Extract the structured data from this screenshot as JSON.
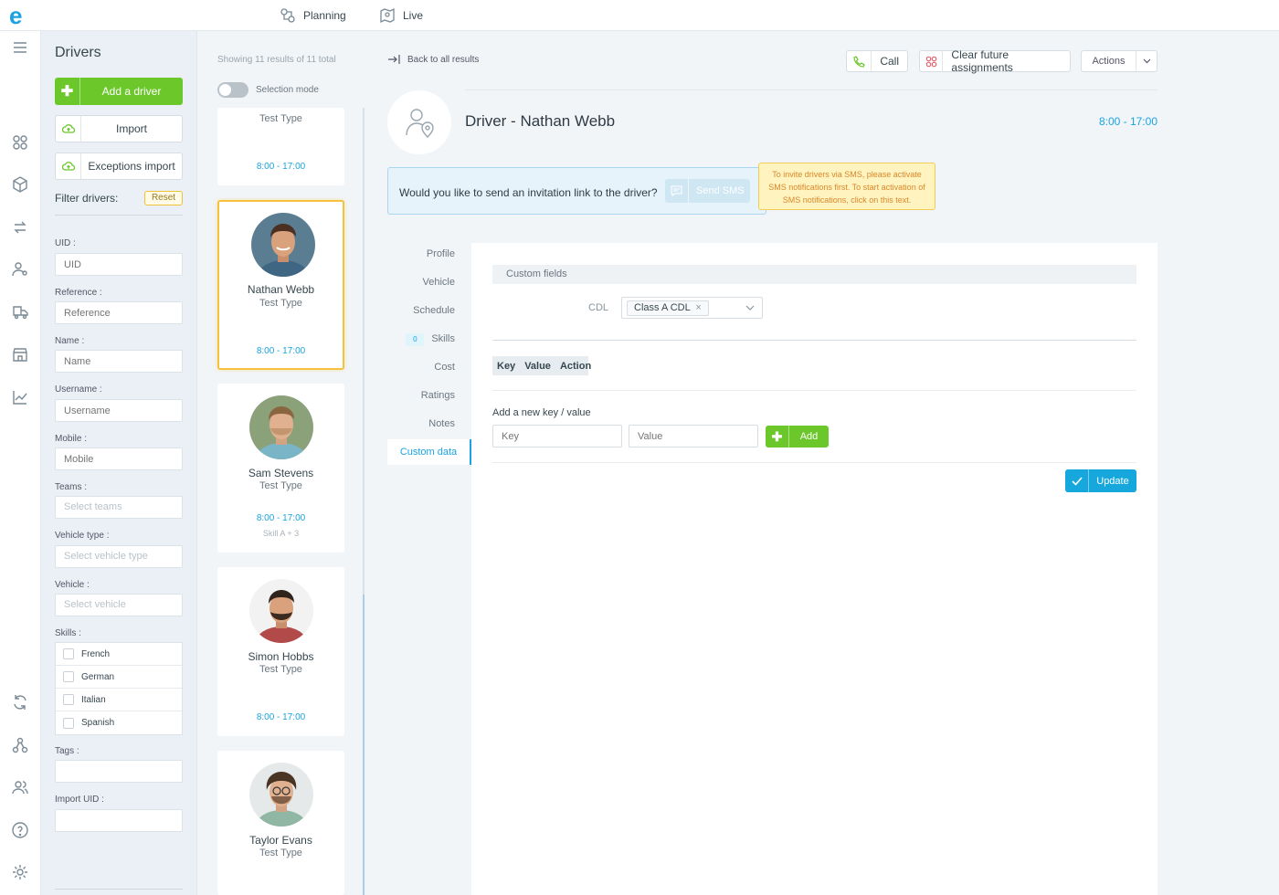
{
  "app": {
    "logo": "e",
    "nav": [
      {
        "label": "Planning",
        "icon": "planning-icon"
      },
      {
        "label": "Live",
        "icon": "live-map-icon"
      }
    ]
  },
  "rail_icons": [
    "menu-icon",
    "planning-icon",
    "package-icon",
    "route-icon",
    "driver-icon",
    "dispatch-icon",
    "store-icon",
    "analytics-icon",
    "sync-icon",
    "integrations-icon",
    "users-icon",
    "help-icon",
    "settings-icon"
  ],
  "filters": {
    "title": "Drivers",
    "add_driver": "Add a driver",
    "import": "Import",
    "exceptions_import": "Exceptions import",
    "filter_label": "Filter drivers:",
    "reset": "Reset",
    "fields": {
      "uid": {
        "label": "UID :",
        "placeholder": "UID"
      },
      "reference": {
        "label": "Reference :",
        "placeholder": "Reference"
      },
      "name": {
        "label": "Name :",
        "placeholder": "Name"
      },
      "username": {
        "label": "Username :",
        "placeholder": "Username"
      },
      "mobile": {
        "label": "Mobile :",
        "placeholder": "Mobile"
      },
      "teams": {
        "label": "Teams :",
        "placeholder": "Select teams"
      },
      "vehicle_type": {
        "label": "Vehicle type :",
        "placeholder": "Select vehicle type"
      },
      "vehicle": {
        "label": "Vehicle :",
        "placeholder": "Select vehicle"
      },
      "skills": {
        "label": "Skills :"
      },
      "tags": {
        "label": "Tags :",
        "placeholder": ""
      },
      "import_uid": {
        "label": "Import UID :",
        "placeholder": ""
      }
    },
    "skills": [
      "French",
      "German",
      "Italian",
      "Spanish"
    ]
  },
  "list": {
    "showing": "Showing 11 results of 11 total",
    "selection_mode": "Selection mode",
    "partial_card": {
      "type": "Test Type",
      "hours": "8:00 - 17:00"
    },
    "drivers": [
      {
        "name": "Nathan Webb",
        "type": "Test Type",
        "hours": "8:00 - 17:00",
        "skills": "",
        "selected": true
      },
      {
        "name": "Sam Stevens",
        "type": "Test Type",
        "hours": "8:00 - 17:00",
        "skills": "Skill A + 3",
        "selected": false
      },
      {
        "name": "Simon Hobbs",
        "type": "Test Type",
        "hours": "8:00 - 17:00",
        "skills": "",
        "selected": false
      },
      {
        "name": "Taylor Evans",
        "type": "Test Type",
        "hours": "",
        "skills": "",
        "selected": false
      }
    ]
  },
  "detail": {
    "back": "Back to all results",
    "call": "Call",
    "clear": "Clear future assignments",
    "actions": "Actions",
    "title": "Driver - Nathan Webb",
    "hours": "8:00 - 17:00",
    "invite_text": "Would you like to send an invitation link to the driver?",
    "send_sms": "Send SMS",
    "tooltip": "To invite drivers via SMS, please activate SMS notifications first. To start activation of SMS notifications, click on this text.",
    "tabs": [
      {
        "label": "Profile"
      },
      {
        "label": "Vehicle"
      },
      {
        "label": "Schedule"
      },
      {
        "label": "Skills",
        "badge": "0"
      },
      {
        "label": "Cost"
      },
      {
        "label": "Ratings"
      },
      {
        "label": "Notes"
      },
      {
        "label": "Custom data",
        "active": true
      }
    ],
    "custom_fields_header": "Custom fields",
    "cdl_label": "CDL",
    "cdl_value": "Class A CDL",
    "kv_headers": [
      "Key",
      "Value",
      "Action"
    ],
    "add_kv": "Add a new key / value",
    "key_placeholder": "Key",
    "value_placeholder": "Value",
    "add": "Add",
    "update": "Update"
  },
  "colors": {
    "accent": "#1aa3e0",
    "green": "#6cc72b",
    "selected_border": "#f6c13c",
    "warning": "#d9882a"
  }
}
